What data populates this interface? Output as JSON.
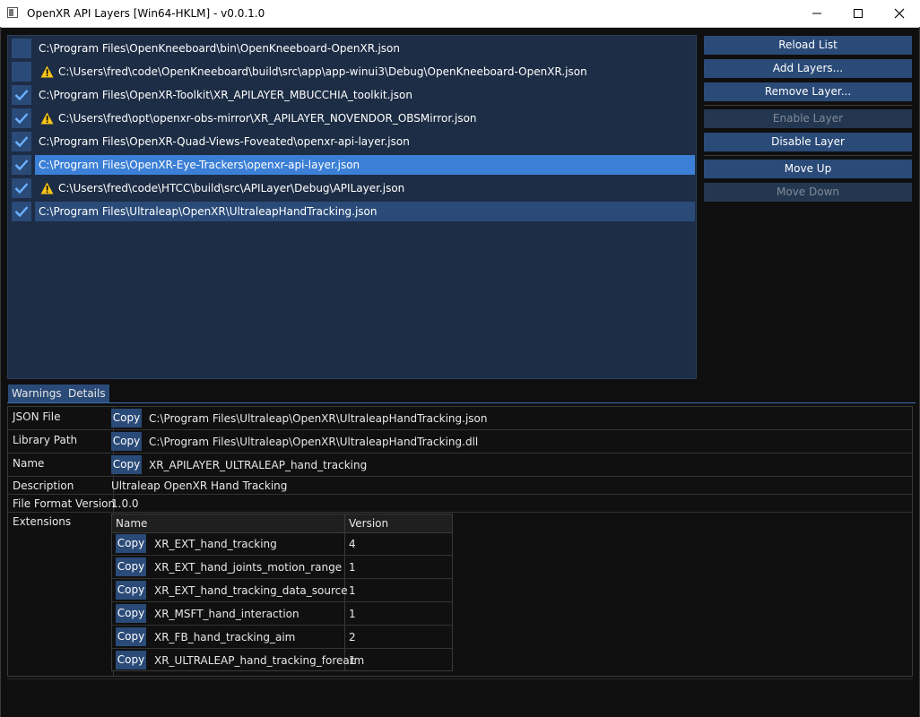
{
  "window": {
    "title": "OpenXR API Layers [Win64-HKLM] - v0.0.1.0",
    "controls": {
      "minimize": "minimize-icon",
      "maximize": "maximize-icon",
      "close": "close-icon"
    }
  },
  "colors": {
    "accent": "#2a4a78",
    "selected": "#3b7fd6",
    "list_bg": "#1d2d45",
    "warning": "#f5c518"
  },
  "layers": [
    {
      "path": "C:\\Program Files\\OpenKneeboard\\bin\\OpenKneeboard-OpenXR.json",
      "enabled": false,
      "warning": false
    },
    {
      "path": "C:\\Users\\fred\\code\\OpenKneeboard\\build\\src\\app\\app-winui3\\Debug\\OpenKneeboard-OpenXR.json",
      "enabled": false,
      "warning": true
    },
    {
      "path": "C:\\Program Files\\OpenXR-Toolkit\\XR_APILAYER_MBUCCHIA_toolkit.json",
      "enabled": true,
      "warning": false
    },
    {
      "path": "C:\\Users\\fred\\opt\\openxr-obs-mirror\\XR_APILAYER_NOVENDOR_OBSMirror.json",
      "enabled": true,
      "warning": true
    },
    {
      "path": "C:\\Program Files\\OpenXR-Quad-Views-Foveated\\openxr-api-layer.json",
      "enabled": true,
      "warning": false
    },
    {
      "path": "C:\\Program Files\\OpenXR-Eye-Trackers\\openxr-api-layer.json",
      "enabled": true,
      "warning": false
    },
    {
      "path": "C:\\Users\\fred\\code\\HTCC\\build\\src\\APILayer\\Debug\\APILayer.json",
      "enabled": true,
      "warning": true
    },
    {
      "path": "C:\\Program Files\\Ultraleap\\OpenXR\\UltraleapHandTracking.json",
      "enabled": true,
      "warning": false
    }
  ],
  "buttons": {
    "reload": "Reload List",
    "add": "Add Layers...",
    "remove": "Remove Layer...",
    "enable": "Enable Layer",
    "disable": "Disable Layer",
    "move_up": "Move Up",
    "move_down": "Move Down"
  },
  "tabs": [
    {
      "label": "Warnings"
    },
    {
      "label": "Details"
    }
  ],
  "details": {
    "copy_label": "Copy",
    "json_file": {
      "label": "JSON File",
      "value": "C:\\Program Files\\Ultraleap\\OpenXR\\UltraleapHandTracking.json"
    },
    "library_path": {
      "label": "Library Path",
      "value": "C:\\Program Files\\Ultraleap\\OpenXR\\UltraleapHandTracking.dll"
    },
    "name": {
      "label": "Name",
      "value": "XR_APILAYER_ULTRALEAP_hand_tracking"
    },
    "description": {
      "label": "Description",
      "value": "Ultraleap OpenXR Hand Tracking"
    },
    "file_format_version": {
      "label": "File Format Version",
      "value": "1.0.0"
    },
    "extensions": {
      "label": "Extensions",
      "headers": {
        "name": "Name",
        "version": "Version"
      },
      "rows": [
        {
          "name": "XR_EXT_hand_tracking",
          "version": "4"
        },
        {
          "name": "XR_EXT_hand_joints_motion_range",
          "version": "1"
        },
        {
          "name": "XR_EXT_hand_tracking_data_source",
          "version": "1"
        },
        {
          "name": "XR_MSFT_hand_interaction",
          "version": "1"
        },
        {
          "name": "XR_FB_hand_tracking_aim",
          "version": "2"
        },
        {
          "name": "XR_ULTRALEAP_hand_tracking_forearm",
          "version": "1"
        }
      ]
    }
  }
}
